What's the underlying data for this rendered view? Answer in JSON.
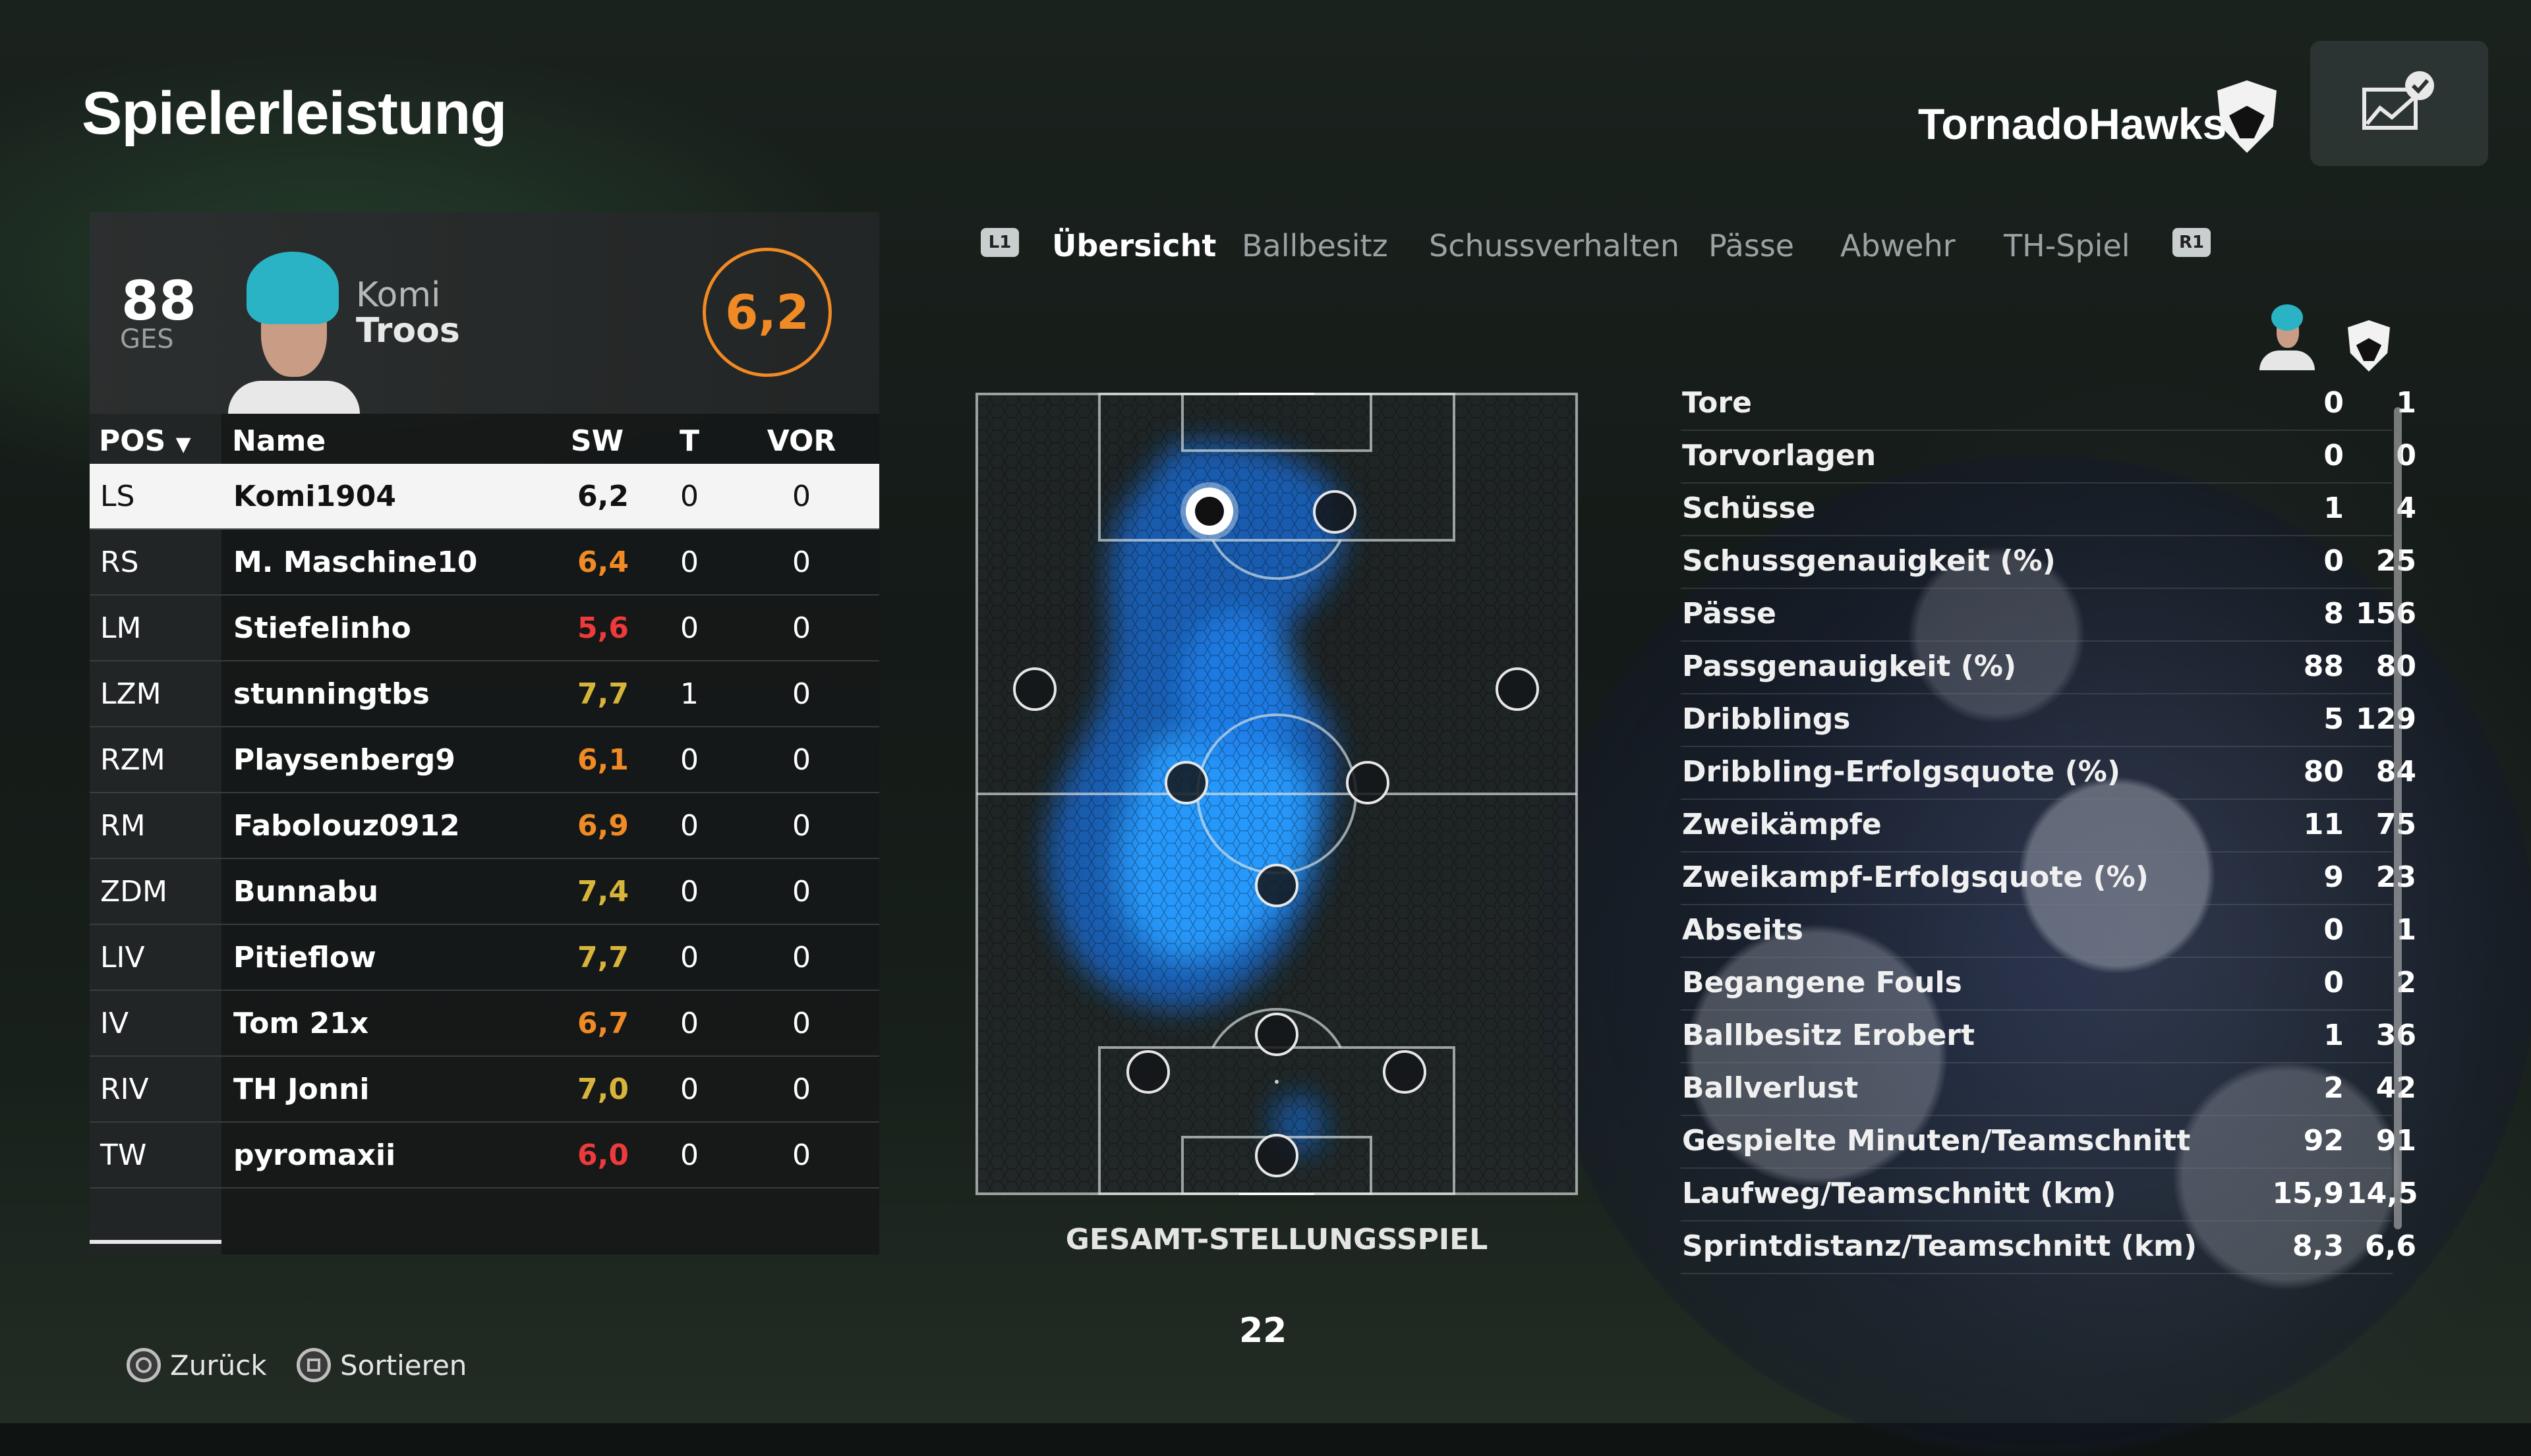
{
  "header": {
    "title": "Spielerleistung",
    "team_name": "TornadoHawks"
  },
  "player_card": {
    "overall": "88",
    "overall_label": "GES",
    "first_name": "Komi",
    "last_name": "Troos",
    "match_rating": "6,2"
  },
  "table": {
    "headers": {
      "pos": "POS",
      "name": "Name",
      "sw": "SW",
      "t": "T",
      "vor": "VOR"
    },
    "rows": [
      {
        "pos": "LS",
        "name": "Komi1904",
        "sw": "6,2",
        "t": "0",
        "vor": "0",
        "color": "#111111"
      },
      {
        "pos": "RS",
        "name": "M. Maschine10",
        "sw": "6,4",
        "t": "0",
        "vor": "0",
        "color": "#f08a24"
      },
      {
        "pos": "LM",
        "name": "Stiefelinho",
        "sw": "5,6",
        "t": "0",
        "vor": "0",
        "color": "#ee3a3a"
      },
      {
        "pos": "LZM",
        "name": "stunningtbs",
        "sw": "7,7",
        "t": "1",
        "vor": "0",
        "color": "#d7b43a"
      },
      {
        "pos": "RZM",
        "name": "Playsenberg9",
        "sw": "6,1",
        "t": "0",
        "vor": "0",
        "color": "#f08a24"
      },
      {
        "pos": "RM",
        "name": "Fabolouz0912",
        "sw": "6,9",
        "t": "0",
        "vor": "0",
        "color": "#f08a24"
      },
      {
        "pos": "ZDM",
        "name": "Bunnabu",
        "sw": "7,4",
        "t": "0",
        "vor": "0",
        "color": "#d7b43a"
      },
      {
        "pos": "LIV",
        "name": "Pitieflow",
        "sw": "7,7",
        "t": "0",
        "vor": "0",
        "color": "#d7b43a"
      },
      {
        "pos": "IV",
        "name": "Tom 21x",
        "sw": "6,7",
        "t": "0",
        "vor": "0",
        "color": "#f08a24"
      },
      {
        "pos": "RIV",
        "name": "TH Jonni",
        "sw": "7,0",
        "t": "0",
        "vor": "0",
        "color": "#d7b43a"
      },
      {
        "pos": "TW",
        "name": "pyromaxii",
        "sw": "6,0",
        "t": "0",
        "vor": "0",
        "color": "#ee3a3a"
      }
    ]
  },
  "tabs": {
    "left_button": "L1",
    "right_button": "R1",
    "items": [
      {
        "label": "Übersicht",
        "active": true
      },
      {
        "label": "Ballbesitz",
        "active": false
      },
      {
        "label": "Schussverhalten",
        "active": false
      },
      {
        "label": "Pässe",
        "active": false
      },
      {
        "label": "Abwehr",
        "active": false
      },
      {
        "label": "TH-Spiel",
        "active": false
      }
    ]
  },
  "pitch": {
    "label": "GESAMT-STELLUNGSSPIEL",
    "page": "22"
  },
  "stats": [
    {
      "label": "Tore",
      "player": "0",
      "team": "1"
    },
    {
      "label": "Torvorlagen",
      "player": "0",
      "team": "0"
    },
    {
      "label": "Schüsse",
      "player": "1",
      "team": "4"
    },
    {
      "label": "Schussgenauigkeit (%)",
      "player": "0",
      "team": "25"
    },
    {
      "label": "Pässe",
      "player": "8",
      "team": "156"
    },
    {
      "label": "Passgenauigkeit (%)",
      "player": "88",
      "team": "80"
    },
    {
      "label": "Dribblings",
      "player": "5",
      "team": "129"
    },
    {
      "label": "Dribbling-Erfolgsquote (%)",
      "player": "80",
      "team": "84"
    },
    {
      "label": "Zweikämpfe",
      "player": "11",
      "team": "75"
    },
    {
      "label": "Zweikampf-Erfolgsquote (%)",
      "player": "9",
      "team": "23"
    },
    {
      "label": "Abseits",
      "player": "0",
      "team": "1"
    },
    {
      "label": "Begangene Fouls",
      "player": "0",
      "team": "2"
    },
    {
      "label": "Ballbesitz Erobert",
      "player": "1",
      "team": "36"
    },
    {
      "label": "Ballverlust",
      "player": "2",
      "team": "42"
    },
    {
      "label": "Gespielte Minuten/Teamschnitt",
      "player": "92",
      "team": "91"
    },
    {
      "label": "Laufweg/Teamschnitt (km)",
      "player": "15,9",
      "team": "14,5"
    },
    {
      "label": "Sprintdistanz/Teamschnitt (km)",
      "player": "8,3",
      "team": "6,6"
    }
  ],
  "footer": {
    "back_label": "Zurück",
    "sort_label": "Sortieren"
  },
  "colors": {
    "accent_orange": "#f08a24",
    "rating_red": "#ee3a3a",
    "rating_yellow": "#d7b43a",
    "heatmap_blue": "#1e90ff"
  }
}
